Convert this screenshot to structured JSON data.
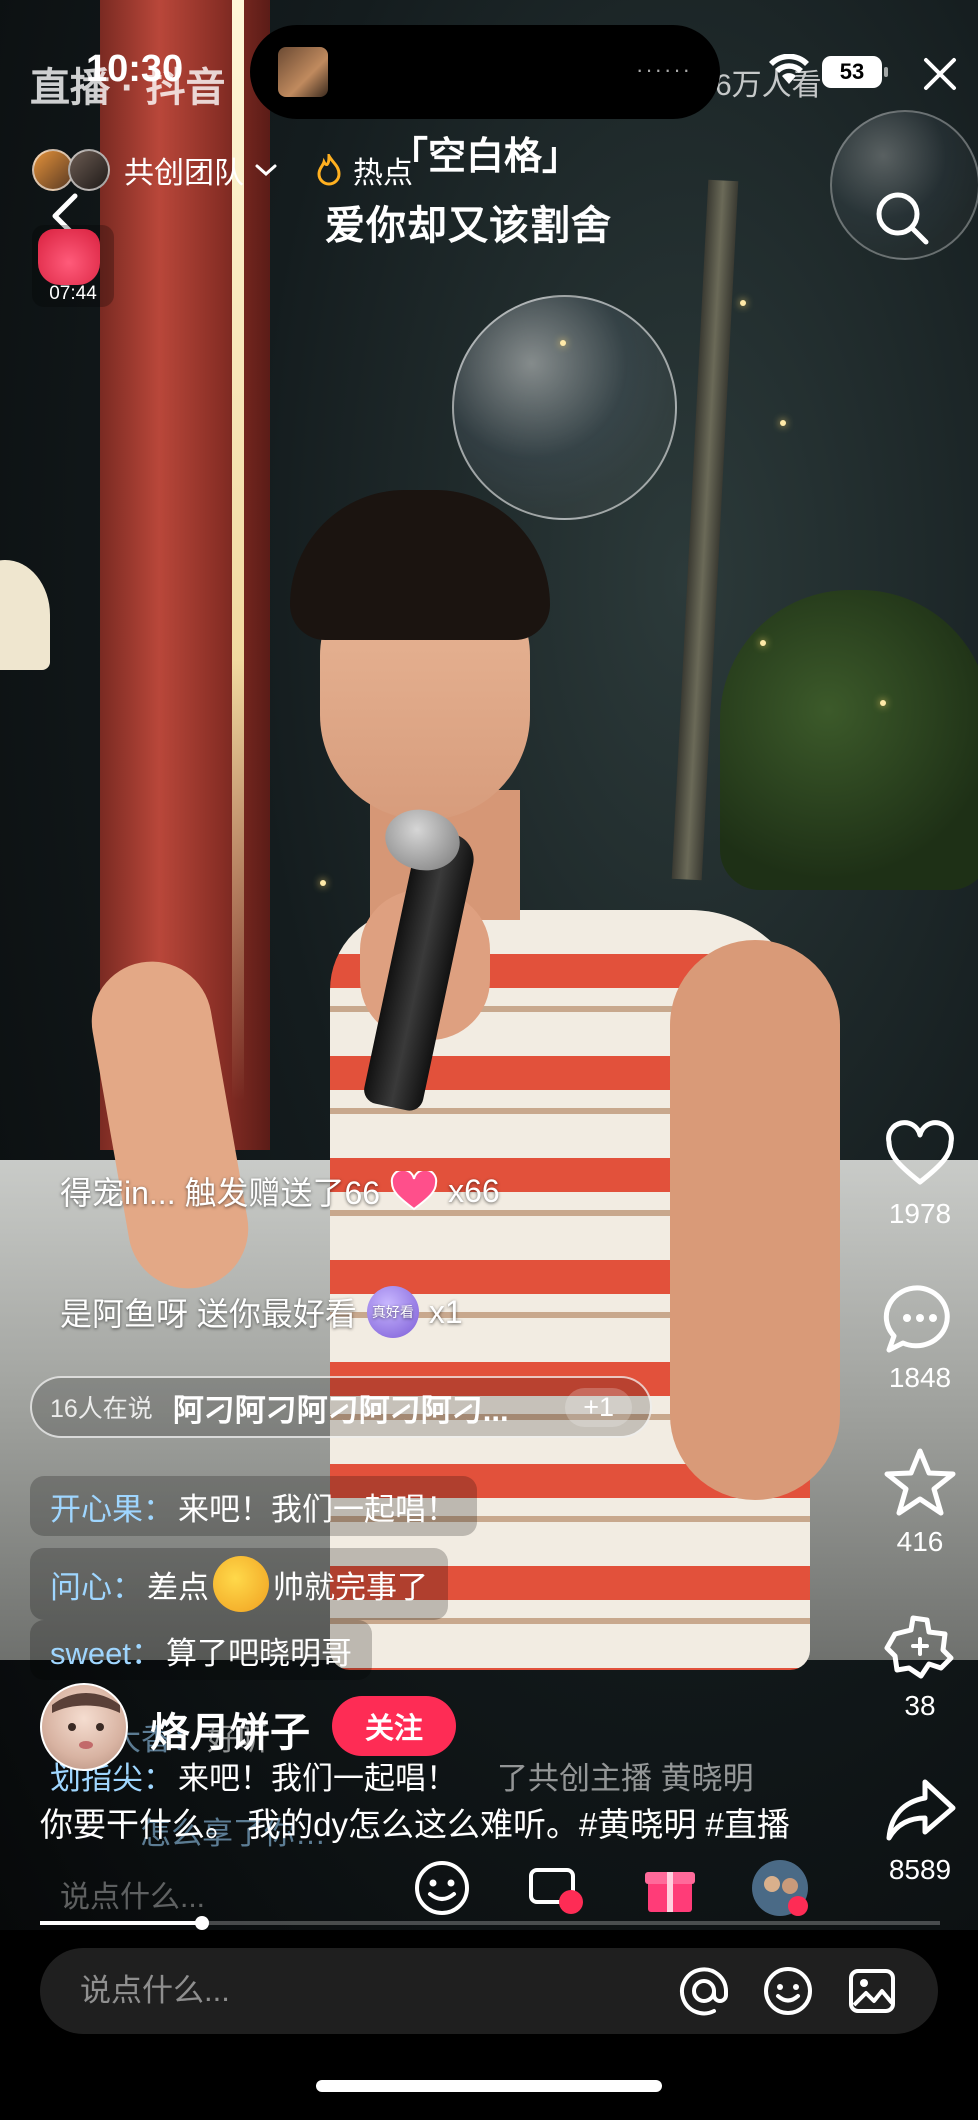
{
  "status_bar": {
    "time": "10:30",
    "battery": "53",
    "island_dots": "······"
  },
  "background_header": {
    "title": "直播 · 抖音",
    "viewers": "6万人看"
  },
  "team": {
    "label": "共创团队"
  },
  "hot": {
    "label": "热点"
  },
  "lyrics": {
    "line1": "「空白格」",
    "line2": "爱你却又该割舍"
  },
  "gift_badge": {
    "timer": "07:44"
  },
  "rail": {
    "likes": "1978",
    "comments": "1848",
    "favorites": "416",
    "fans": "38",
    "shares": "8589"
  },
  "notices": [
    {
      "text": "得宠in... 触发赠送了66",
      "suffix": "x66"
    },
    {
      "text": "是阿鱼呀 送你最好看",
      "suffix": "x1",
      "gift_text": "真好看"
    }
  ],
  "hot_talk": {
    "count": "16人在说",
    "text": "阿刁阿刁阿刁阿刁阿刁...",
    "plus": "+1"
  },
  "comments": [
    {
      "name": "开心果：",
      "text": "来吧！我们一起唱！"
    },
    {
      "name": "问心：",
      "text_before": "差点",
      "text_after": "帅就完事了"
    },
    {
      "name": "sweet：",
      "text": "算了吧晓明哥"
    },
    {
      "name": "大香：",
      "text": "好听"
    },
    {
      "name": "划指尖：",
      "text": "来吧！我们一起唱！",
      "tail": "了共创主播 黄晓明"
    },
    {
      "name": "",
      "text": "怎么享了你…"
    }
  ],
  "host": {
    "name": "烙月饼子",
    "follow": "关注"
  },
  "caption": "你要干什么。 我的dy怎么这么难听。#黄晓明 #直播",
  "video_input": {
    "placeholder": "说点什么..."
  },
  "comment_bar": {
    "placeholder": "说点什么..."
  },
  "progress": {
    "fraction": 0.18
  },
  "colors": {
    "follow": "#fe2c55",
    "comment_name": "#9fd6ff"
  }
}
